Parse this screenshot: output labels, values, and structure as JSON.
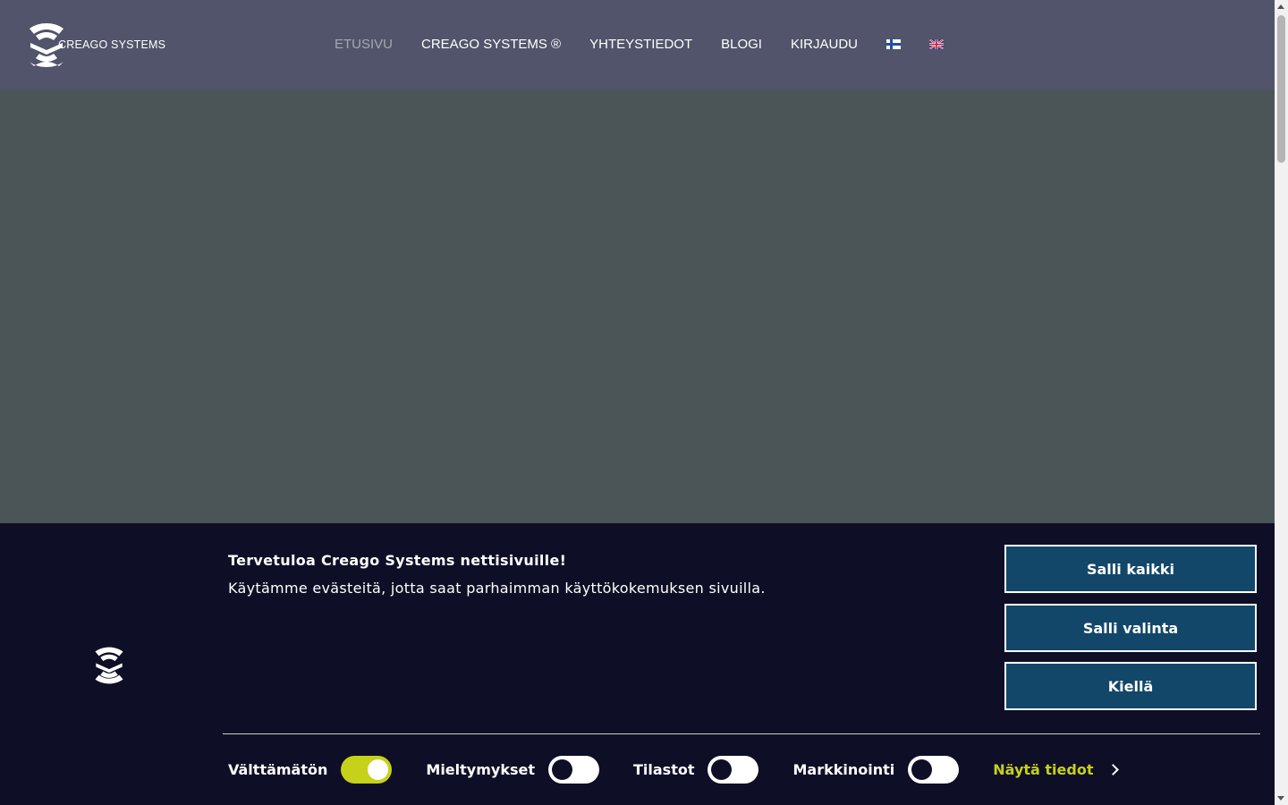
{
  "brand": {
    "name": "CREAGO SYSTEMS"
  },
  "nav": {
    "items": [
      {
        "label": "ETUSIVU",
        "active": true
      },
      {
        "label": "CREAGO SYSTEMS ®"
      },
      {
        "label": "YHTEYSTIEDOT"
      },
      {
        "label": "BLOGI"
      },
      {
        "label": "KIRJAUDU"
      }
    ],
    "languages": [
      "finnish-flag-icon",
      "english-flag-icon"
    ]
  },
  "cookie_banner": {
    "title": "Tervetuloa Creago Systems nettisivuille!",
    "text": "Käytämme evästeitä, jotta saat parhaimman käyttökokemuksen sivuilla.",
    "buttons": {
      "allow_all": "Salli kaikki",
      "allow_selection": "Salli valinta",
      "deny": "Kiellä"
    },
    "toggles": [
      {
        "label": "Välttämätön",
        "on": true
      },
      {
        "label": "Mieltymykset",
        "on": false
      },
      {
        "label": "Tilastot",
        "on": false
      },
      {
        "label": "Markkinointi",
        "on": false
      }
    ],
    "details_link": "Näytä tiedot"
  },
  "colors": {
    "navbar": "#51546a",
    "page_overlay": "#4b5558",
    "banner_bg": "#0e0f26",
    "button_bg": "#12476a",
    "accent": "#c6d11a"
  }
}
